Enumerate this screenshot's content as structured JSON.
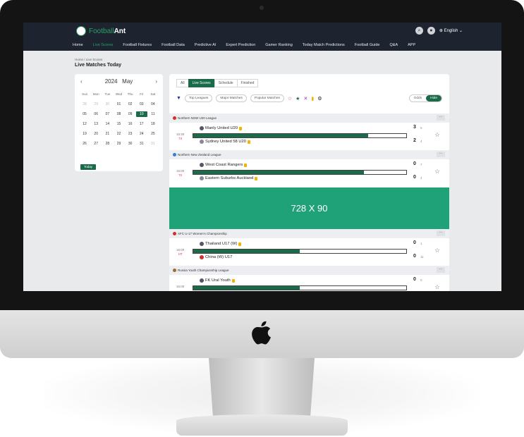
{
  "header": {
    "logo_prefix": "Football",
    "logo_suffix": "Ant",
    "language": "English"
  },
  "nav": [
    "Home",
    "Live Scores",
    "Football Fixtures",
    "Football Data",
    "Predictive AI",
    "Expert Prediction",
    "Gamer Ranking",
    "Today Match Predictions",
    "Football Guide",
    "Q&A",
    "APP"
  ],
  "breadcrumb": "Home  /  Live Scores",
  "page_title": "Live Matches Today",
  "calendar": {
    "year": "2024",
    "month": "May",
    "dows": [
      "Sun",
      "Mon",
      "Tue",
      "Wed",
      "Thu",
      "Fri",
      "Sat"
    ],
    "weeks": [
      [
        "28",
        "29",
        "30",
        "01",
        "02",
        "03",
        "04"
      ],
      [
        "05",
        "06",
        "07",
        "08",
        "09",
        "10",
        "11"
      ],
      [
        "12",
        "13",
        "14",
        "15",
        "16",
        "17",
        "18"
      ],
      [
        "19",
        "20",
        "21",
        "22",
        "23",
        "24",
        "25"
      ],
      [
        "26",
        "27",
        "28",
        "29",
        "30",
        "31",
        "01"
      ]
    ],
    "selected": "10",
    "today_label": "Today"
  },
  "tabs": [
    "All",
    "Live Scores",
    "Schedule",
    "Finished"
  ],
  "filters": [
    "Top Leagues",
    "Major Matches",
    "Popular Matches"
  ],
  "odds_toggle": {
    "off": "Odds",
    "on": "Hide"
  },
  "leagues": [
    {
      "name": "Northern NSW U20 League",
      "flag_color": "#d32f2f",
      "match": {
        "time": "15:30",
        "minute": "74",
        "home": "Manly United U20",
        "away": "Sydney United 58 U20",
        "home_score": "3",
        "away_score": "2",
        "home_corners": "5",
        "away_corners": "4",
        "progress": 0.82
      }
    },
    {
      "name": "Northern New Zealand League",
      "flag_color": "#3a7bd5",
      "match": {
        "time": "15:00",
        "minute": "72",
        "home": "West Coast Rangers",
        "away": "Eastern Suburbs Auckland",
        "home_score": "0",
        "away_score": "0",
        "home_corners": "7",
        "away_corners": "4",
        "progress": 0.8
      }
    },
    {
      "name": "AFC U-17 Women's Championship",
      "flag_color": "#d32f2f",
      "match": {
        "time": "16:00",
        "minute": "HT",
        "home": "Thailand U17 (W)",
        "away": "China (W) U17",
        "home_score": "0",
        "away_score": "0",
        "home_corners": "1",
        "away_corners": "11",
        "progress": 0.5
      }
    },
    {
      "name": "Russia Youth Championship League",
      "flag_color": "#9c6b2f",
      "match": {
        "time": "16:00",
        "minute": "",
        "home": "FK Ural Youth",
        "away": "",
        "home_score": "0",
        "away_score": "",
        "home_corners": "0",
        "away_corners": "",
        "progress": 0.5
      }
    }
  ],
  "ad_label": "728 X 90"
}
